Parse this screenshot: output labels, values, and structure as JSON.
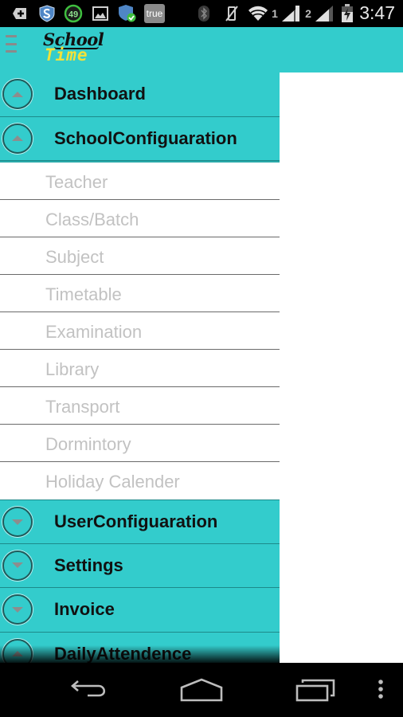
{
  "status_bar": {
    "left_icons": [
      {
        "name": "add-notification-icon"
      },
      {
        "name": "shield-s-icon"
      },
      {
        "name": "battery-level-circle-icon",
        "value": "49"
      },
      {
        "name": "image-icon"
      },
      {
        "name": "shield-check-icon"
      },
      {
        "name": "true-badge-icon",
        "label": "true"
      }
    ],
    "right_icons": [
      {
        "name": "bluetooth-icon"
      },
      {
        "name": "vibrate-off-icon"
      },
      {
        "name": "wifi-icon"
      },
      {
        "name": "signal-sim1-icon",
        "label": "1"
      },
      {
        "name": "signal-sim2-icon",
        "label": "2"
      },
      {
        "name": "battery-charging-icon"
      }
    ],
    "time": "3:47"
  },
  "app_bar": {
    "menu_icon": "hamburger-icon",
    "logo": {
      "line1": "School",
      "line2": "Time"
    }
  },
  "colors": {
    "primary": "#33cccc",
    "logo_yellow": "#f2e23a",
    "group_text": "#111111",
    "child_text": "#c2c2c2"
  },
  "drawer": {
    "groups_top": [
      {
        "label": "Dashboard",
        "state": "expanded-arrow-up"
      },
      {
        "label": "SchoolConfiguaration",
        "state": "expanded-arrow-up"
      }
    ],
    "school_configuration_items": [
      {
        "label": "Teacher"
      },
      {
        "label": "Class/Batch"
      },
      {
        "label": "Subject"
      },
      {
        "label": "Timetable"
      },
      {
        "label": "Examination"
      },
      {
        "label": "Library"
      },
      {
        "label": "Transport"
      },
      {
        "label": "Dormintory"
      },
      {
        "label": "Holiday Calender"
      }
    ],
    "groups_bottom": [
      {
        "label": "UserConfiguaration",
        "state": "collapsed-arrow-down"
      },
      {
        "label": "Settings",
        "state": "collapsed-arrow-down"
      },
      {
        "label": "Invoice",
        "state": "collapsed-arrow-down"
      },
      {
        "label": "DailyAttendence",
        "state": "expanded-arrow-up"
      }
    ]
  },
  "nav_bar": {
    "buttons": [
      {
        "name": "back-button"
      },
      {
        "name": "home-button"
      },
      {
        "name": "recent-apps-button"
      },
      {
        "name": "overflow-menu-button"
      }
    ]
  }
}
